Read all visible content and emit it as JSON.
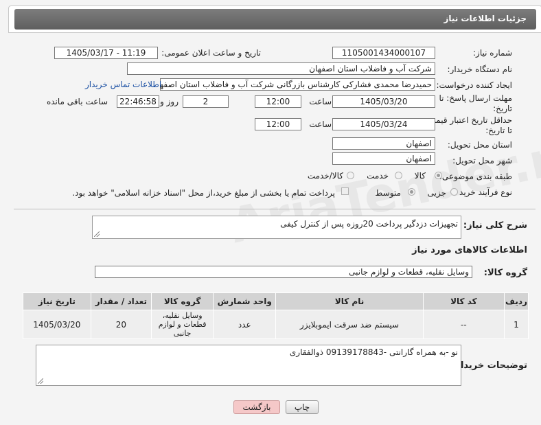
{
  "header": {
    "title": "جزئیات اطلاعات نیاز"
  },
  "form": {
    "need_number_label": "شماره نیاز:",
    "need_number": "1105001434000107",
    "announce_label": "تاریخ و ساعت اعلان عمومی:",
    "announce_value": "1405/03/17 - 11:19",
    "buyer_org_label": "نام دستگاه خریدار:",
    "buyer_org": "شرکت آب و فاضلاب استان اصفهان",
    "creator_label": "ایجاد کننده درخواست:",
    "creator": "حمیدرضا محمدی فشارکی کارشناس بازرگانی شرکت آب و فاضلاب استان اصفهان",
    "contact_link": "اطلاعات تماس خریدار",
    "deadline_label_1": "مهلت ارسال پاسخ: تا",
    "deadline_label_2": "تاریخ:",
    "deadline_date": "1405/03/20",
    "time_label": "ساعت",
    "deadline_time": "12:00",
    "days_value": "2",
    "days_label": "روز و",
    "remaining_time": "22:46:58",
    "remaining_label": "ساعت باقی مانده",
    "min_validity_label_1": "حداقل تاریخ اعتبار قیمت:",
    "min_validity_label_2": "تا تاریخ:",
    "validity_date": "1405/03/24",
    "validity_time": "12:00",
    "province_label": "استان محل تحویل:",
    "province": "اصفهان",
    "city_label": "شهر محل تحویل:",
    "city": "اصفهان",
    "category_label": "طبقه بندی موضوعی:",
    "category_options": [
      "کالا",
      "خدمت",
      "کالا/خدمت"
    ],
    "process_label": "نوع فرآیند خرید :",
    "process_options": [
      "جزیی",
      "متوسط"
    ],
    "payment_note": "پرداخت تمام یا بخشی از مبلغ خرید،از محل \"اسناد خزانه اسلامی\" خواهد بود."
  },
  "description": {
    "label": "شرح کلی نیاز:",
    "value": "تجهیزات دزدگیر پرداخت 20روزه پس از کنترل کیفی"
  },
  "goods_section": {
    "title": "اطلاعات کالاهای مورد نیاز",
    "group_label": "گروه کالا:",
    "group_value": "وسایل نقلیه، قطعات و لوازم جانبی"
  },
  "table": {
    "headers": [
      "ردیف",
      "کد کالا",
      "نام کالا",
      "واحد شمارش",
      "گروه کالا",
      "تعداد / مقدار",
      "تاریخ نیاز"
    ],
    "rows": [
      [
        "1",
        "--",
        "سیستم ضد سرقت ایموبلایزر",
        "عدد",
        "وسایل نقلیه، قطعات و لوازم جانبی",
        "20",
        "1405/03/20"
      ]
    ]
  },
  "buyer_notes": {
    "label": "توضیحات خریدار:",
    "value": "نو -به همراه گارانتی -09139178843 ذوالفقاری"
  },
  "buttons": {
    "print": "چاپ",
    "back": "بازگشت"
  },
  "watermark": "AriaTender.neT"
}
